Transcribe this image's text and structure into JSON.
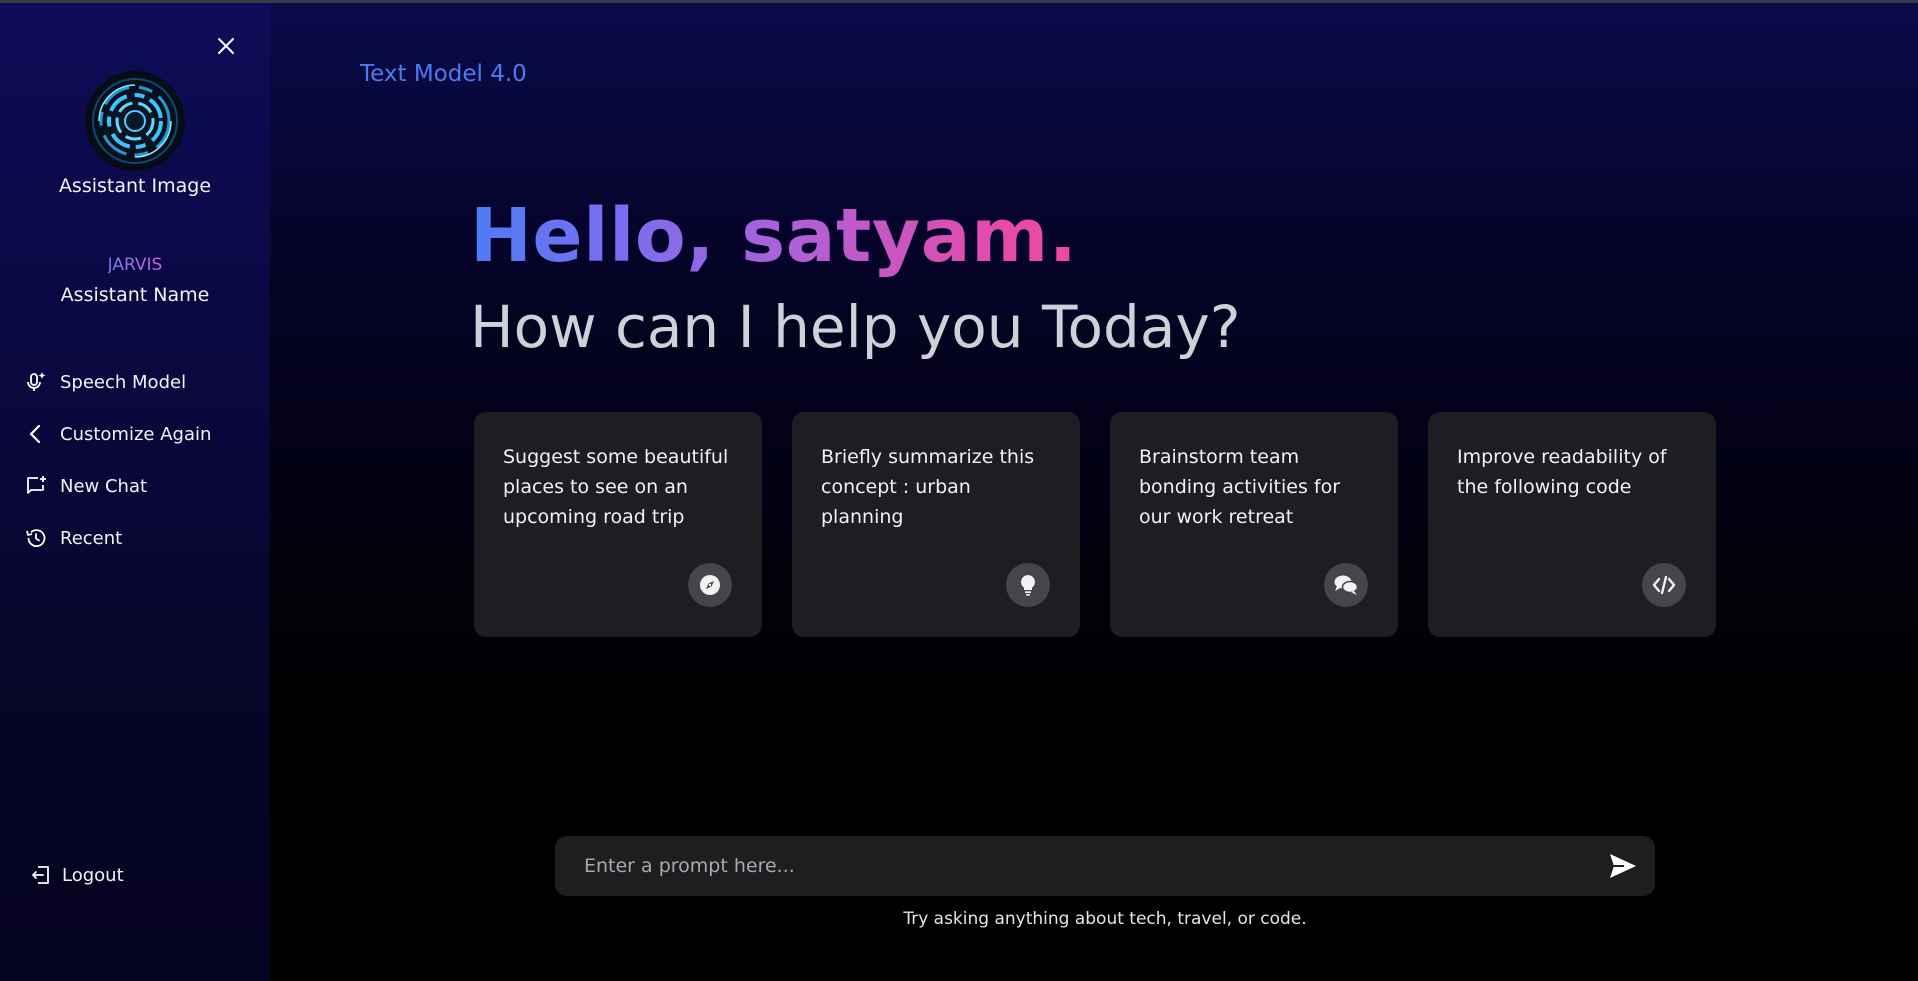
{
  "sidebar": {
    "assistant_image_label": "Assistant Image",
    "assistant_name_value": "JARVIS",
    "assistant_name_label": "Assistant Name",
    "menu": [
      {
        "label": "Speech Model",
        "icon": "mic-sparkle-icon"
      },
      {
        "label": "Customize Again",
        "icon": "chevron-left-icon"
      },
      {
        "label": "New Chat",
        "icon": "new-chat-icon"
      },
      {
        "label": "Recent",
        "icon": "history-icon"
      }
    ],
    "logout_label": "Logout"
  },
  "header": {
    "model_title": "Text Model 4.0"
  },
  "greeting": {
    "hello": "Hello, satyam.",
    "subtitle": "How can I help you Today?"
  },
  "cards": [
    {
      "text": "Suggest some beautiful places to see on an upcoming road trip",
      "icon": "compass-icon"
    },
    {
      "text": "Briefly summarize this concept : urban planning",
      "icon": "lightbulb-icon"
    },
    {
      "text": "Brainstorm team bonding activities for our work retreat",
      "icon": "chat-bubbles-icon"
    },
    {
      "text": "Improve readability of the following code",
      "icon": "code-icon"
    }
  ],
  "prompt": {
    "placeholder": "Enter a prompt here...",
    "value": "",
    "hint": "Try asking anything about tech, travel, or code."
  },
  "colors": {
    "accent_blue": "#4a7cf0",
    "gradient_start": "#4e7bf6",
    "gradient_end": "#ee48a2",
    "card_bg": "#1d1d22",
    "prompt_bg": "#1e1e20"
  }
}
